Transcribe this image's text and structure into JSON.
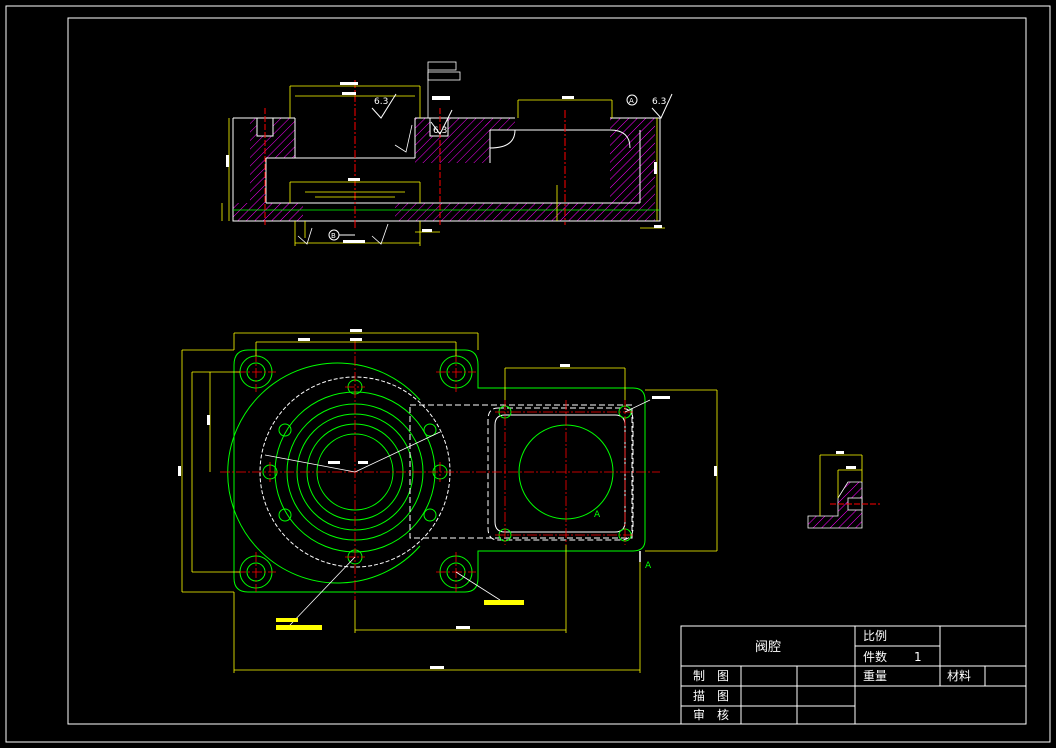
{
  "title_block": {
    "part_name": "阀腔",
    "scale_label": "比例",
    "count_label": "件数",
    "count_value": "1",
    "weight_label": "重量",
    "material_label": "材料",
    "drawn_label": "制　图",
    "traced_label": "描　图",
    "checked_label": "审　核"
  },
  "annotations": {
    "roughness_1": "6.3",
    "roughness_2": "6.3",
    "roughness_3": "6.3",
    "datum_a": "A",
    "datum_b": "B",
    "section_a_1": "A",
    "section_a_2": "A"
  },
  "colors": {
    "background": "#000000",
    "border": "#ffffff",
    "object": "#00ff00",
    "dimension": "#ffff00",
    "center": "#ff0000",
    "hatch": "#ff00ff",
    "text": "#ffffff",
    "hidden": "#ffffff"
  }
}
